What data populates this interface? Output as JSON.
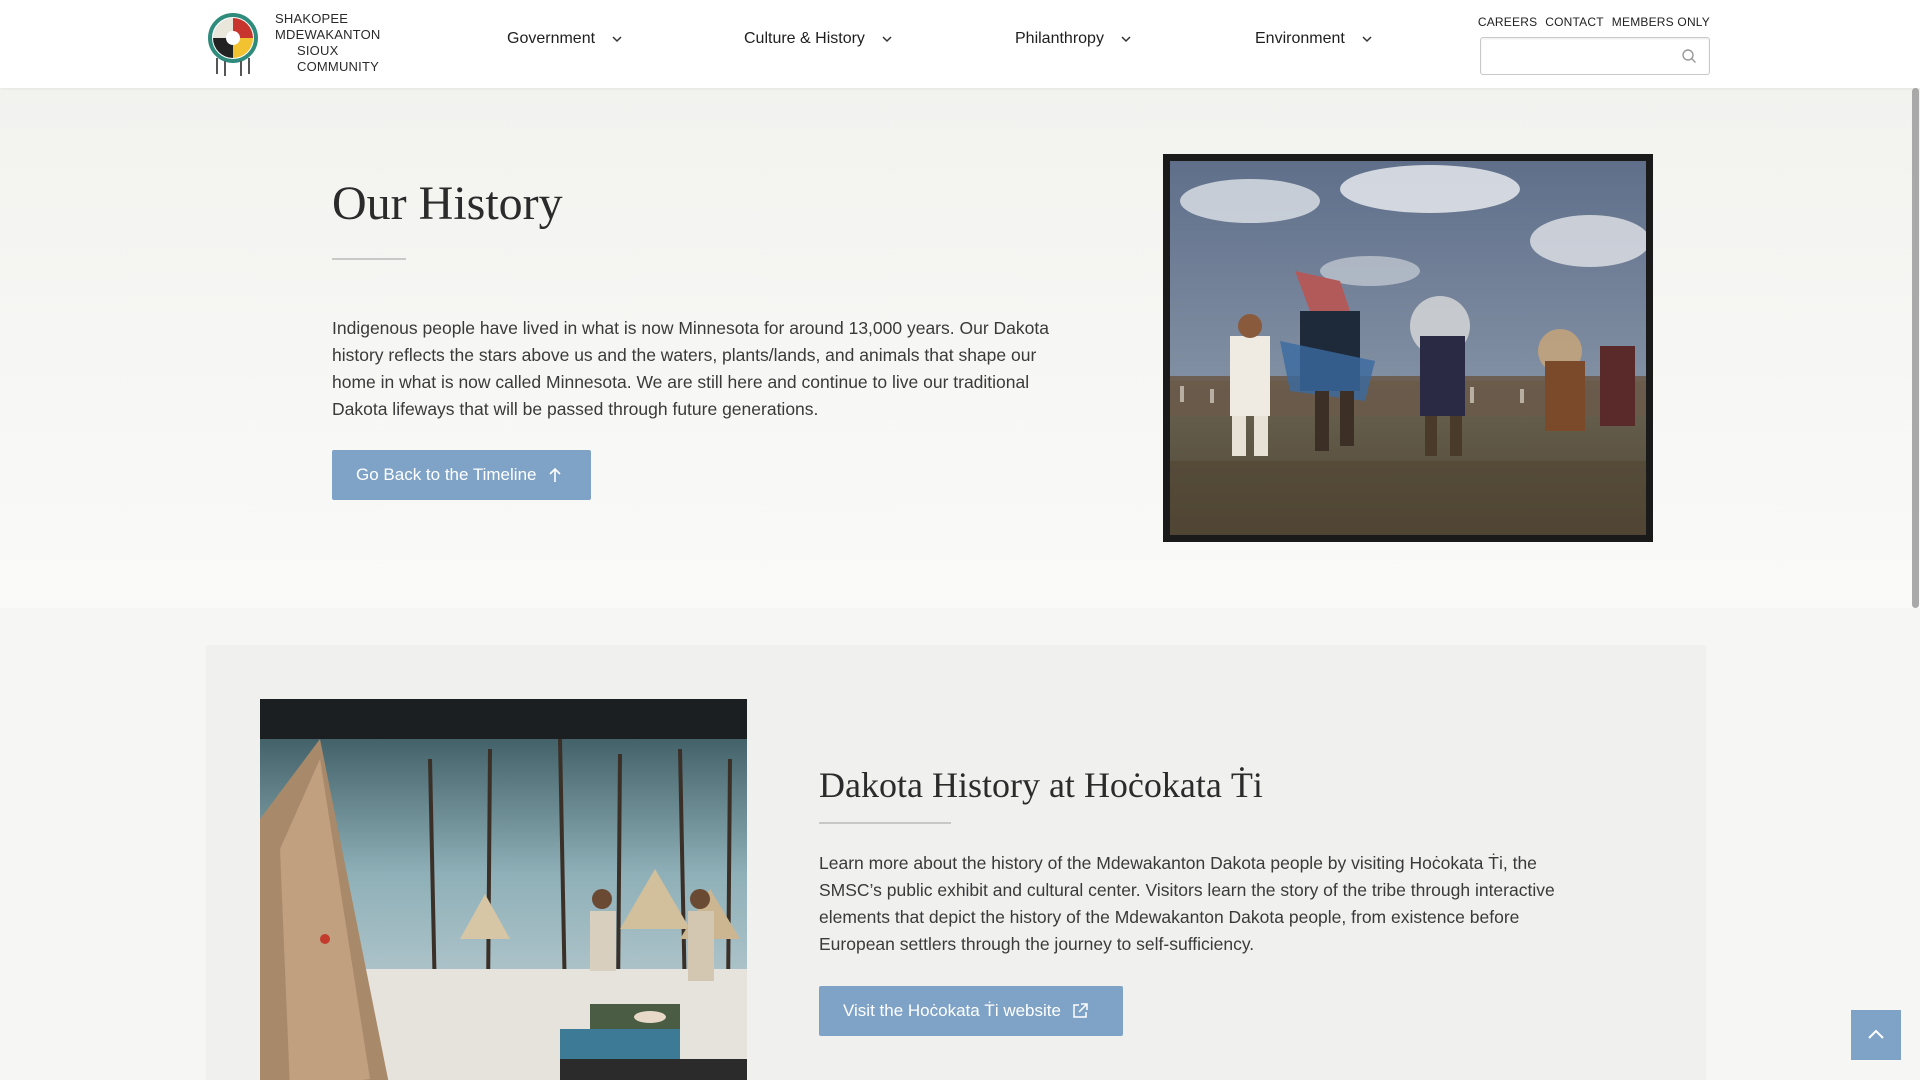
{
  "header": {
    "logo_line1": "Shakopee Mdewakanton",
    "logo_line2": "Sioux Community",
    "nav": [
      {
        "label": "Government"
      },
      {
        "label": "Culture & History"
      },
      {
        "label": "Philanthropy"
      },
      {
        "label": "Environment"
      }
    ],
    "utility": {
      "careers": "CAREERS",
      "contact": "CONTACT",
      "members": "MEMBERS ONLY"
    },
    "search": {
      "value": "",
      "placeholder": ""
    }
  },
  "hero": {
    "title": "Our History",
    "body": "Indigenous people have lived in what is now Minnesota for around 13,000 years. Our Dakota history reflects the stars above us and the waters, plants/lands, and animals that shape our home in what is now called Minnesota. We are still here and continue to live our traditional Dakota lifeways that will be passed through future generations.",
    "button_label": "Go Back to the Timeline"
  },
  "section": {
    "title": "Dakota History at Hoċokata Ṫi",
    "body": "Learn more about the history of the Mdewakanton Dakota people by visiting Hoċokata Ṫi, the SMSC’s public exhibit and cultural center. Visitors learn the story of the tribe through interactive elements that depict the history of the Mdewakanton Dakota people, from existence before European settlers through the journey to self-sufficiency.",
    "button_label": "Visit the Hoċokata Ṫi website"
  },
  "colors": {
    "accent": "#7fa3c6",
    "text": "#3a3a3a",
    "panel": "#f0f0ef"
  },
  "icons": {
    "nav_chevron": "chevron-down-icon",
    "search": "search-icon",
    "back_to_top": "chevron-up-icon",
    "external": "external-link-icon",
    "arrow_up": "arrow-up-icon"
  }
}
